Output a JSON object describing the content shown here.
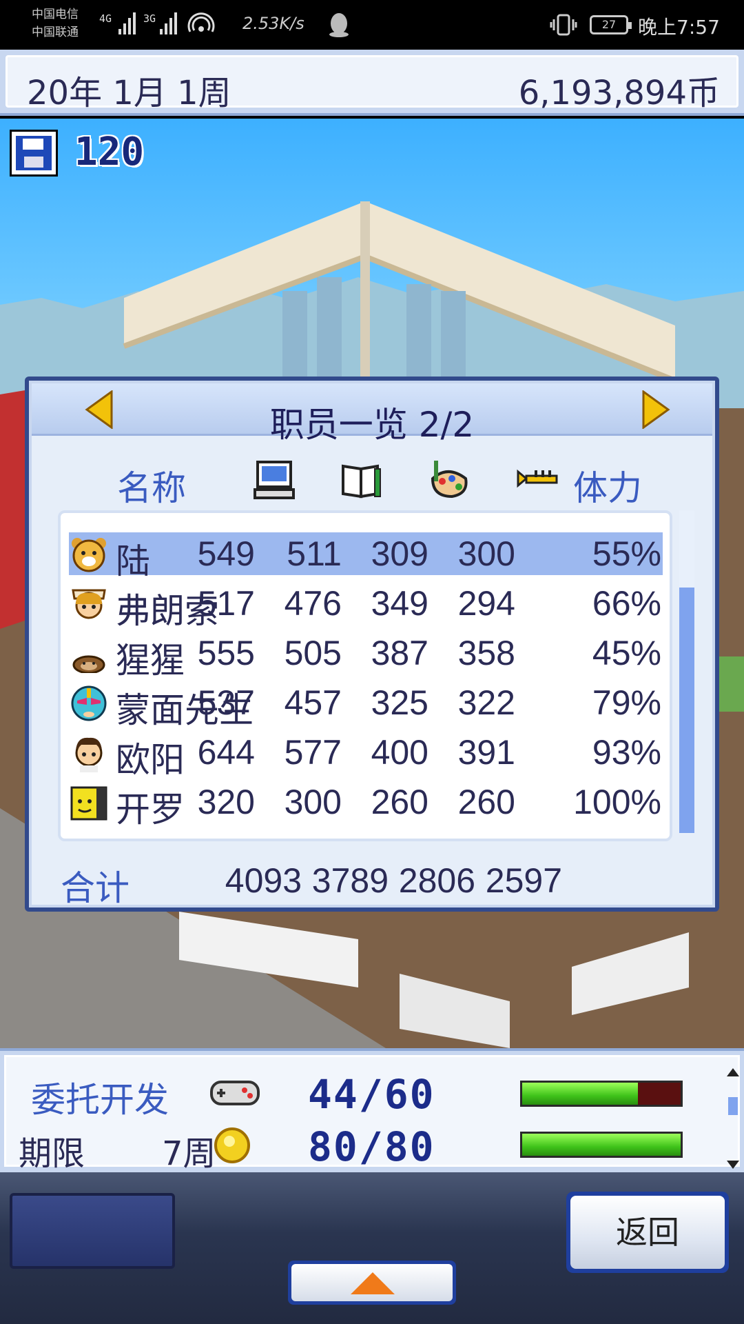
{
  "status_bar": {
    "carrier1": "中国电信",
    "carrier2": "中国联通",
    "signal1": "4G",
    "signal2": "3G",
    "net_speed": "2.53K/s",
    "battery": "27",
    "time": "晚上7:57"
  },
  "top_bar": {
    "date": "20年 1月 1周",
    "money": "6,193,894币"
  },
  "save": {
    "count": "120"
  },
  "staff_panel": {
    "title": "职员一览 2/2",
    "columns": {
      "name": "名称",
      "stamina": "体力",
      "icons": [
        "computer-icon",
        "book-pencil-icon",
        "paint-palette-icon",
        "trumpet-icon"
      ]
    },
    "rows": [
      {
        "name": "陆",
        "v1": "549",
        "v2": "511",
        "v3": "309",
        "v4": "300",
        "stamina": "55%",
        "avatar": "bear-avatar",
        "selected": true
      },
      {
        "name": "弗朗索",
        "v1": "517",
        "v2": "476",
        "v3": "349",
        "v4": "294",
        "stamina": "66%",
        "avatar": "girl-avatar",
        "selected": false
      },
      {
        "name": "猩猩",
        "v1": "555",
        "v2": "505",
        "v3": "387",
        "v4": "358",
        "stamina": "45%",
        "avatar": "gorilla-avatar",
        "selected": false
      },
      {
        "name": "蒙面先生",
        "v1": "537",
        "v2": "457",
        "v3": "325",
        "v4": "322",
        "stamina": "79%",
        "avatar": "masked-avatar",
        "selected": false
      },
      {
        "name": "欧阳",
        "v1": "644",
        "v2": "577",
        "v3": "400",
        "v4": "391",
        "stamina": "93%",
        "avatar": "boy-avatar",
        "selected": false
      },
      {
        "name": "开罗",
        "v1": "320",
        "v2": "300",
        "v3": "260",
        "v4": "260",
        "stamina": "100%",
        "avatar": "yellow-block-avatar",
        "selected": false
      }
    ],
    "total": {
      "label": "合计",
      "values": [
        "4093",
        "3789",
        "2806",
        "2597"
      ]
    }
  },
  "info_panel": {
    "contract_label": "委托开发",
    "deadline_label": "期限",
    "deadline_value": "7周",
    "progress1": "44/60",
    "progress2": "80/80",
    "bar1_fraction": 0.73,
    "bar2_fraction": 1.0
  },
  "controls": {
    "back_label": "返回"
  },
  "colors": {
    "accent_blue": "#3a5bc0",
    "text_dark": "#2a2a55",
    "selected_row": "#9cb8ef",
    "bar_green": "#3fc21a",
    "bar_empty": "#5a1010"
  }
}
